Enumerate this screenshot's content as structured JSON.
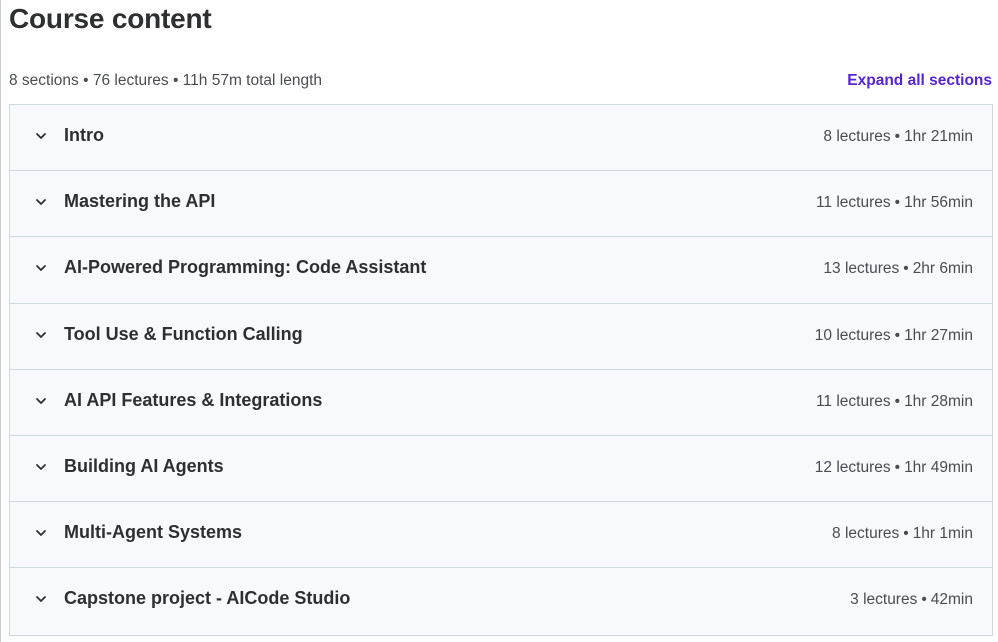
{
  "header": {
    "title": "Course content",
    "summary": "8 sections • 76 lectures • 11h 57m total length",
    "expand_label": "Expand all sections"
  },
  "colors": {
    "accent": "#5624d0",
    "section_bg": "#f7f9fa",
    "border": "#d1d7dc"
  },
  "sections": [
    {
      "title": "Intro",
      "lectures": "8 lectures",
      "duration": "1hr 21min",
      "icon": "chevron-down-icon"
    },
    {
      "title": "Mastering the API",
      "lectures": "11 lectures",
      "duration": "1hr 56min",
      "icon": "chevron-down-icon"
    },
    {
      "title": "AI-Powered Programming: Code Assistant",
      "lectures": "13 lectures",
      "duration": "2hr 6min",
      "icon": "chevron-down-icon"
    },
    {
      "title": "Tool Use & Function Calling",
      "lectures": "10 lectures",
      "duration": "1hr 27min",
      "icon": "chevron-down-icon"
    },
    {
      "title": "AI API Features & Integrations",
      "lectures": "11 lectures",
      "duration": "1hr 28min",
      "icon": "chevron-down-icon"
    },
    {
      "title": "Building AI Agents",
      "lectures": "12 lectures",
      "duration": "1hr 49min",
      "icon": "chevron-down-icon"
    },
    {
      "title": "Multi-Agent Systems",
      "lectures": "8 lectures",
      "duration": "1hr 1min",
      "icon": "chevron-down-icon"
    },
    {
      "title": "Capstone project - AICode Studio",
      "lectures": "3 lectures",
      "duration": "42min",
      "icon": "chevron-down-icon"
    }
  ]
}
